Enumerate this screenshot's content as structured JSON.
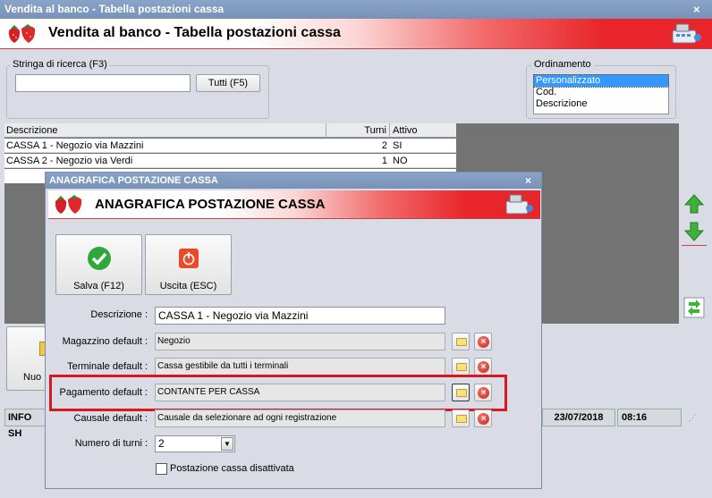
{
  "window": {
    "title": "Vendita al banco - Tabella postazioni cassa",
    "close": "×"
  },
  "header": {
    "title": "Vendita al banco - Tabella postazioni cassa"
  },
  "search": {
    "legend": "Stringa di ricerca (F3)",
    "value": "",
    "all_button": "Tutti (F5)"
  },
  "ordering": {
    "legend": "Ordinamento",
    "options": [
      "Personalizzato",
      "Cod.",
      "Descrizione"
    ],
    "selected": "Personalizzato"
  },
  "table": {
    "headers": [
      "Descrizione",
      "Turni",
      "Attivo"
    ],
    "rows": [
      {
        "descrizione": "CASSA 1 - Negozio via Mazzini",
        "turni": "2",
        "attivo": "SI"
      },
      {
        "descrizione": "CASSA 2 - Negozio via Verdi",
        "turni": "1",
        "attivo": "NO"
      }
    ]
  },
  "bottom": {
    "new_button": "Nuo",
    "info": "INFO SH",
    "date": "23/07/2018",
    "time": "08:16"
  },
  "dialog": {
    "title": "ANAGRAFICA POSTAZIONE CASSA",
    "header": "ANAGRAFICA POSTAZIONE CASSA",
    "close": "×",
    "save_button": "Salva (F12)",
    "exit_button": "Uscita (ESC)",
    "fields": {
      "descrizione": {
        "label": "Descrizione :",
        "value": "CASSA 1 - Negozio via Mazzini"
      },
      "magazzino": {
        "label": "Magazzino default :",
        "value": "Negozio"
      },
      "terminale": {
        "label": "Terminale default :",
        "value": "Cassa gestibile da tutti i terminali"
      },
      "pagamento": {
        "label": "Pagamento default :",
        "value": "CONTANTE PER CASSA"
      },
      "causale": {
        "label": "Causale default :",
        "value": "Causale da selezionare ad ogni registrazione"
      },
      "turni": {
        "label": "Numero di turni :",
        "value": "2"
      },
      "disattivata": {
        "label": "Postazione cassa disattivata",
        "checked": false
      }
    }
  },
  "colors": {
    "highlight": "#d7191f",
    "title_bar": "#7f98c0",
    "selection": "#3399ff"
  }
}
